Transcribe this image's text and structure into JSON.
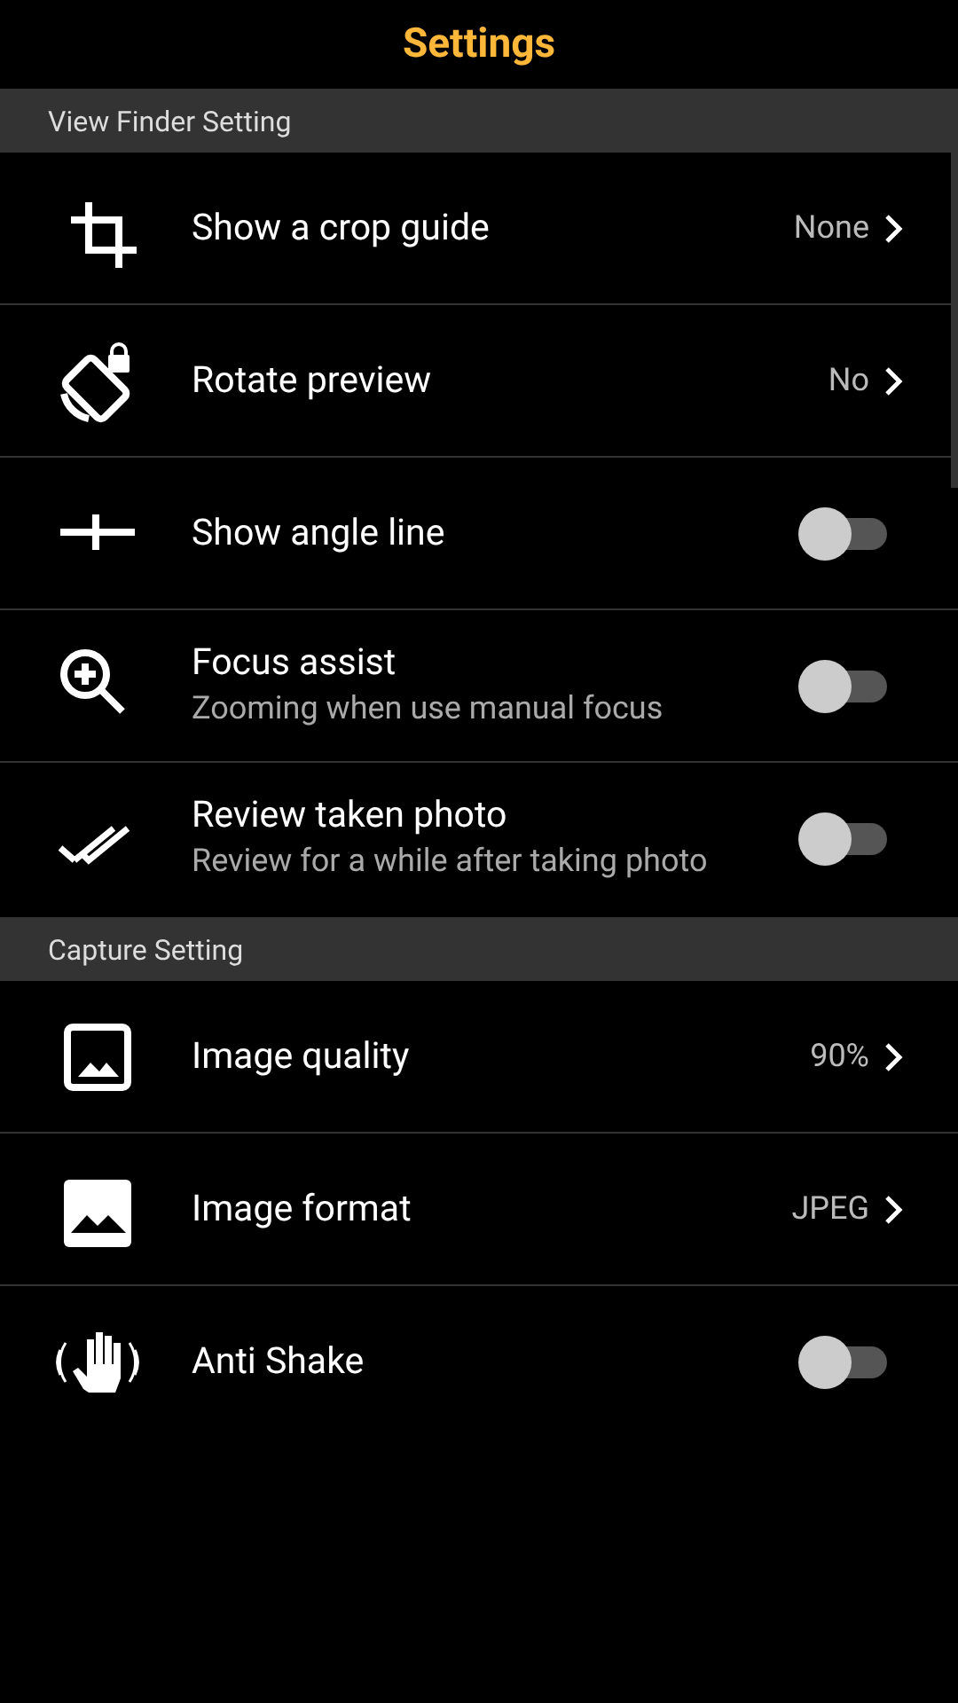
{
  "title": "Settings",
  "sections": [
    {
      "header": "View Finder Setting",
      "items": [
        {
          "kind": "choice",
          "label": "Show a crop guide",
          "value": "None"
        },
        {
          "kind": "choice",
          "label": "Rotate preview",
          "value": "No"
        },
        {
          "kind": "toggle",
          "label": "Show angle line",
          "on": false
        },
        {
          "kind": "toggle",
          "label": "Focus assist",
          "subtitle": "Zooming when use manual focus",
          "on": false
        },
        {
          "kind": "toggle",
          "label": "Review taken photo",
          "subtitle": "Review for a while after taking photo",
          "on": false
        }
      ]
    },
    {
      "header": "Capture Setting",
      "items": [
        {
          "kind": "choice",
          "label": "Image quality",
          "value": "90%"
        },
        {
          "kind": "choice",
          "label": "Image format",
          "value": "JPEG"
        },
        {
          "kind": "toggle",
          "label": "Anti Shake",
          "on": false
        }
      ]
    }
  ]
}
